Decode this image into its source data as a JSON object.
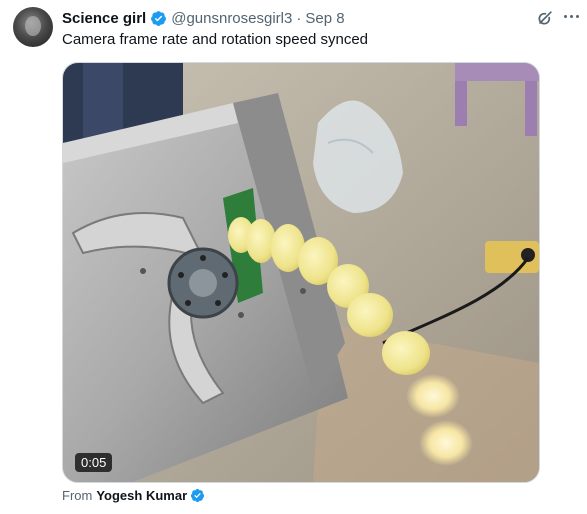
{
  "tweet": {
    "author_name": "Science girl",
    "handle": "@gunsnrosesgirl3",
    "separator": "·",
    "date": "Sep 8",
    "text": "Camera frame rate and rotation speed synced"
  },
  "media": {
    "duration": "0:05"
  },
  "attribution": {
    "prefix": "From",
    "name": "Yogesh Kumar"
  },
  "colors": {
    "verified": "#1d9bf0",
    "secondary_text": "#536471",
    "primary_text": "#0f1419"
  },
  "icons": {
    "grok": "grok-icon",
    "more": "more-options-icon",
    "verified": "verified-badge-icon"
  }
}
